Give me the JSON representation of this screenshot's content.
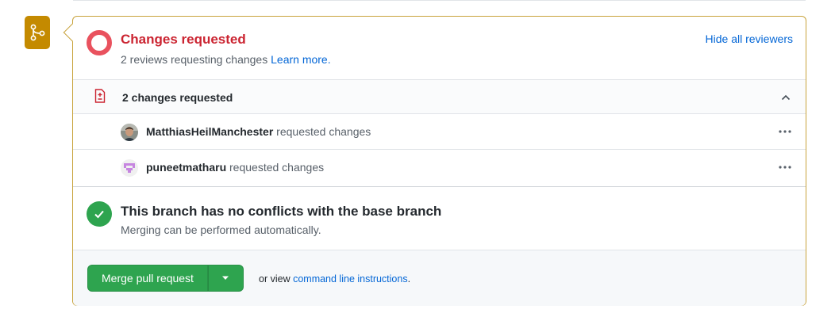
{
  "review_status": {
    "title": "Changes requested",
    "subtitle": "2 reviews requesting changes",
    "learn_more": "Learn more.",
    "hide_reviewers": "Hide all reviewers",
    "status_color": "#cb2431"
  },
  "changes_summary": {
    "label": "2 changes requested"
  },
  "reviewers": [
    {
      "name": "MatthiasHeilManchester",
      "action": "requested changes",
      "avatar": "photo-avatar"
    },
    {
      "name": "puneetmatharu",
      "action": "requested changes",
      "avatar": "identicon-avatar"
    }
  ],
  "branch_status": {
    "title": "This branch has no conflicts with the base branch",
    "subtitle": "Merging can be performed automatically.",
    "status_color": "#2ea44f"
  },
  "merge": {
    "button_label": "Merge pull request",
    "note_prefix": "or view",
    "instructions_link": "command line instructions",
    "note_suffix": ".",
    "button_color": "#2ea44f"
  },
  "icons": {
    "badge": "git-merge-icon",
    "changes": "file-diff-icon",
    "collapse": "chevron-up-icon",
    "more": "kebab-horizontal-icon",
    "success": "check-icon",
    "dropdown": "triangle-down-icon"
  }
}
